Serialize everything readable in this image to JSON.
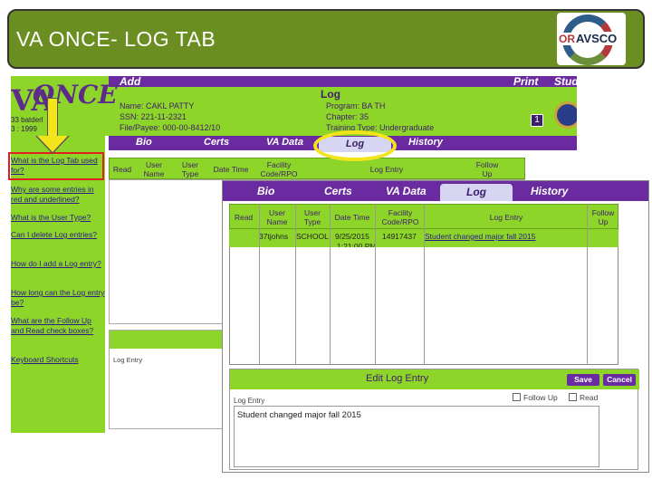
{
  "slide": {
    "title": "VA ONCE- LOG TAB"
  },
  "logo": {
    "or": "OR",
    "name": "AVSCO"
  },
  "back_app": {
    "add_label": "Add",
    "print_label": "Print",
    "stud_label": "Stud",
    "brand": "ONCE",
    "brand_va": "VA",
    "brand_sub_1": "33 batderl",
    "brand_sub_2": "3 : 1999",
    "section_title": "Log",
    "student": {
      "name": "Name: CAKL PATTY",
      "ssn": "SSN: 221-11-2321",
      "file_payee": "File/Payee: 000-00-8412/10",
      "program": "Program: BA TH",
      "chapter": "Chapter: 35",
      "training": "Training Type: Undergraduate"
    },
    "badge": "1",
    "tabs": [
      "Bio",
      "Certs",
      "VA Data",
      "Log",
      "History"
    ],
    "active_tab": "Log",
    "sidebar_links": [
      "What is the Log Tab used for?",
      "Why are some entries in red and underlined?",
      "What is the User Type?",
      "Can I delete Log entries?",
      "How do I add a Log entry?",
      "How long can the Log entry be?",
      "What are the Follow Up and Read check boxes?",
      "Keyboard Shortcuts"
    ],
    "columns": [
      "Read",
      "User Name",
      "User Type",
      "Date Time",
      "Facility Code/RPO",
      "Log Entry",
      "Follow Up"
    ],
    "edit_label": "Log Entry"
  },
  "front_app": {
    "tabs": [
      "Bio",
      "Certs",
      "VA Data",
      "Log",
      "History"
    ],
    "active_tab": "Log",
    "columns": [
      "Read",
      "User Name",
      "User Type",
      "Date Time",
      "Facility Code/RPO",
      "Log Entry",
      "Follow Up"
    ],
    "row": {
      "user_name": "37tjohns",
      "user_type": "SCHOOL",
      "date": "9/25/2015",
      "time": "1:21:00 PM",
      "facility": "14917437",
      "entry": "Student changed major fall 2015"
    },
    "edit": {
      "title": "Edit Log Entry",
      "save": "Save",
      "cancel": "Cancel",
      "log_entry_label": "Log Entry",
      "follow_up": "Follow Up",
      "read": "Read",
      "text": "Student changed major fall 2015"
    }
  }
}
